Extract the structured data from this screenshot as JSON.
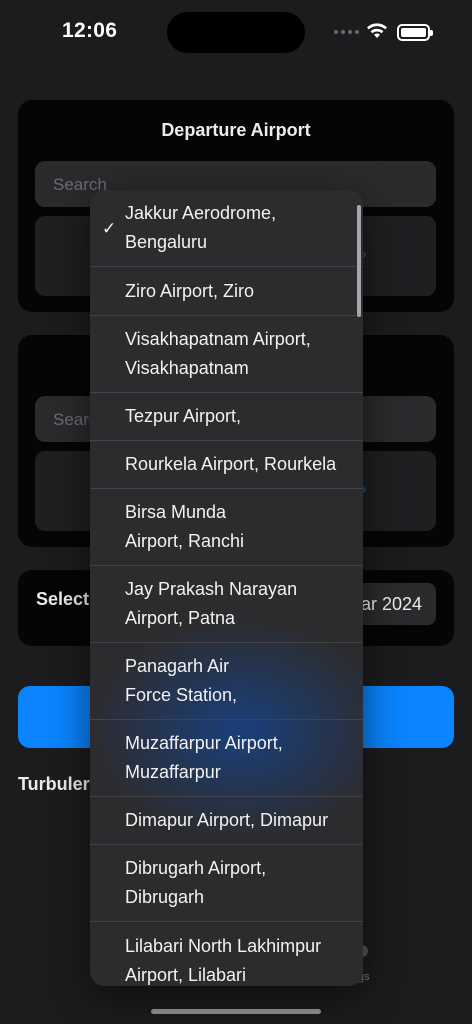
{
  "status": {
    "time": "12:06"
  },
  "departure": {
    "title": "Departure Airport",
    "search_placeholder": "Search"
  },
  "arrival": {
    "search_placeholder": "Search"
  },
  "date": {
    "label": "Select",
    "value": "ar 2024"
  },
  "turbulence": {
    "label": "Turbuler"
  },
  "tabbar": {
    "settings_label": "gs"
  },
  "dropdown": {
    "items": [
      {
        "label": "Jakkur Aerodrome, Bengaluru",
        "selected": true
      },
      {
        "label": "Ziro Airport, Ziro",
        "selected": false
      },
      {
        "label": "Visakhapatnam Airport, Visakhapatnam",
        "selected": false
      },
      {
        "label": "Tezpur Airport,",
        "selected": false
      },
      {
        "label": "Rourkela Airport, Rourkela",
        "selected": false
      },
      {
        "label": "Birsa Munda Airport, Ranchi",
        "selected": false
      },
      {
        "label": "Jay Prakash Narayan Airport, Patna",
        "selected": false
      },
      {
        "label": "Panagarh Air Force Station,",
        "selected": false
      },
      {
        "label": "Muzaffarpur Airport, Muzaffarpur",
        "selected": false
      },
      {
        "label": "Dimapur Airport, Dimapur",
        "selected": false
      },
      {
        "label": "Dibrugarh Airport, Dibrugarh",
        "selected": false
      },
      {
        "label": "Lilabari North Lakhimpur Airport, Lilabari",
        "selected": false
      }
    ],
    "checkmark": "✓"
  },
  "colors": {
    "accent": "#0a84ff",
    "background": "#1c1c1e",
    "menu": "#2c2c2f"
  }
}
